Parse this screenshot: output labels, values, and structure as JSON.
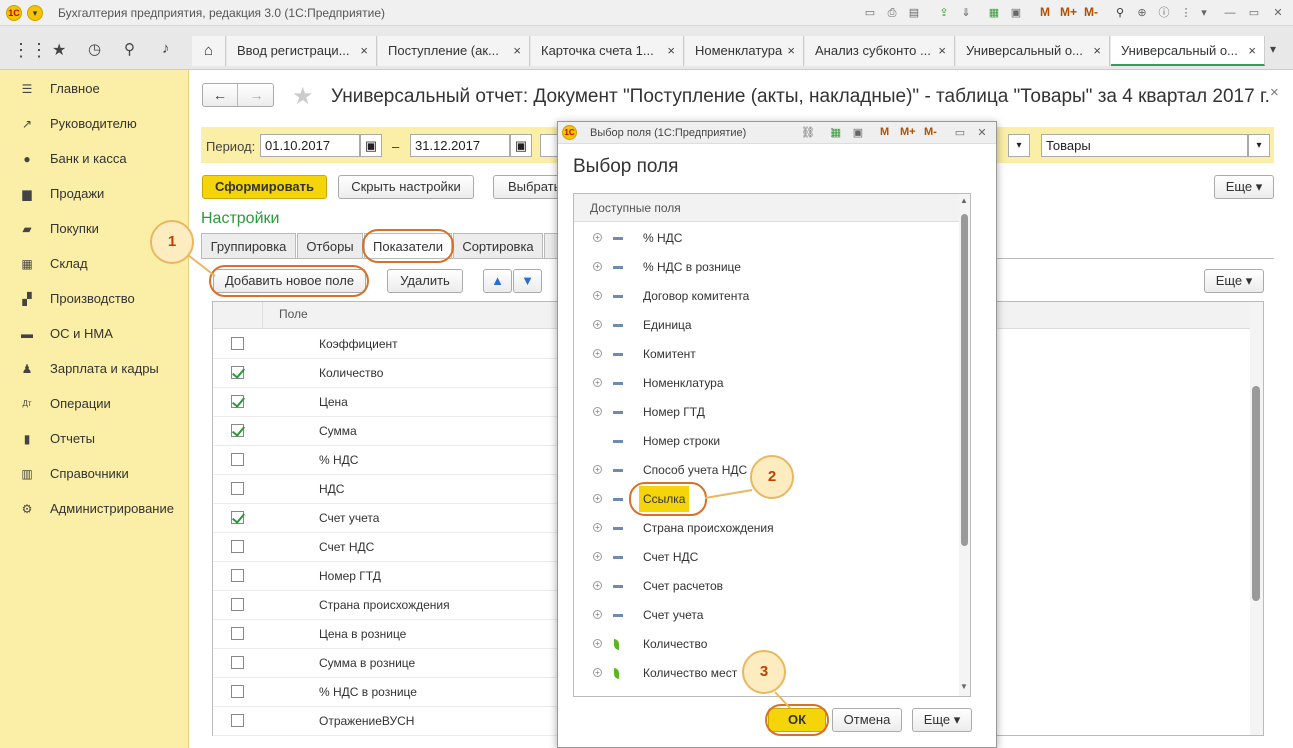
{
  "window": {
    "title": "Бухгалтерия предприятия, редакция 3.0 (1С:Предприятие)",
    "logo": "1С",
    "toolbar": {
      "m": "M",
      "m_plus": "M+",
      "m_minus": "M-"
    }
  },
  "tabs": [
    {
      "label": "Ввод регистраци..."
    },
    {
      "label": "Поступление (ак..."
    },
    {
      "label": "Карточка счета 1..."
    },
    {
      "label": "Номенклатура"
    },
    {
      "label": "Анализ субконто ..."
    },
    {
      "label": "Универсальный о..."
    },
    {
      "label": "Универсальный о..."
    }
  ],
  "tab_close": "×",
  "sidebar": {
    "items": [
      {
        "label": "Главное",
        "icon": "menu-icon"
      },
      {
        "label": "Руководителю",
        "icon": "chart-icon"
      },
      {
        "label": "Банк и касса",
        "icon": "coin-icon"
      },
      {
        "label": "Продажи",
        "icon": "cart-icon"
      },
      {
        "label": "Покупки",
        "icon": "truck-icon"
      },
      {
        "label": "Склад",
        "icon": "warehouse-icon"
      },
      {
        "label": "Производство",
        "icon": "factory-icon"
      },
      {
        "label": "ОС и НМА",
        "icon": "car-icon"
      },
      {
        "label": "Зарплата и кадры",
        "icon": "person-icon"
      },
      {
        "label": "Операции",
        "icon": "dt-kt-icon"
      },
      {
        "label": "Отчеты",
        "icon": "bar-chart-icon"
      },
      {
        "label": "Справочники",
        "icon": "book-icon"
      },
      {
        "label": "Администрирование",
        "icon": "gear-icon"
      }
    ]
  },
  "report": {
    "title": "Универсальный отчет: Документ \"Поступление (акты, накладные)\" - таблица \"Товары\" за 4 квартал 2017 г.",
    "period_label": "Период:",
    "date_from": "01.10.2017",
    "dash": "–",
    "date_to": "31.12.2017",
    "table_select": "Товары",
    "generate_button": "Сформировать",
    "hide_settings_button": "Скрыть настройки",
    "choose_button": "Выбрать",
    "more_button": "Еще",
    "settings_heading": "Настройки",
    "settings_tabs": [
      "Группировка",
      "Отборы",
      "Показатели",
      "Сортировка"
    ],
    "add_field_button": "Добавить новое поле",
    "delete_button": "Удалить",
    "more_button2": "Еще",
    "column_header": "Поле",
    "rows": [
      {
        "label": "Коэффициент",
        "checked": false
      },
      {
        "label": "Количество",
        "checked": true
      },
      {
        "label": "Цена",
        "checked": true
      },
      {
        "label": "Сумма",
        "checked": true
      },
      {
        "label": "% НДС",
        "checked": false
      },
      {
        "label": "НДС",
        "checked": false
      },
      {
        "label": "Счет учета",
        "checked": true
      },
      {
        "label": "Счет НДС",
        "checked": false
      },
      {
        "label": "Номер ГТД",
        "checked": false
      },
      {
        "label": "Страна происхождения",
        "checked": false
      },
      {
        "label": "Цена в рознице",
        "checked": false
      },
      {
        "label": "Сумма в рознице",
        "checked": false
      },
      {
        "label": "% НДС в рознице",
        "checked": false
      },
      {
        "label": "ОтражениеВУСН",
        "checked": false
      }
    ]
  },
  "dialog": {
    "window_title": "Выбор поля  (1С:Предприятие)",
    "heading": "Выбор поля",
    "list_header": "Доступные поля",
    "fields": [
      {
        "label": "% НДС",
        "expand": true,
        "kind": "dim"
      },
      {
        "label": "% НДС в рознице",
        "expand": true,
        "kind": "dim"
      },
      {
        "label": "Договор комитента",
        "expand": true,
        "kind": "dim"
      },
      {
        "label": "Единица",
        "expand": true,
        "kind": "dim"
      },
      {
        "label": "Комитент",
        "expand": true,
        "kind": "dim"
      },
      {
        "label": "Номенклатура",
        "expand": true,
        "kind": "dim"
      },
      {
        "label": "Номер ГТД",
        "expand": true,
        "kind": "dim"
      },
      {
        "label": "Номер строки",
        "expand": false,
        "kind": "dim"
      },
      {
        "label": "Способ учета НДС",
        "expand": true,
        "kind": "dim"
      },
      {
        "label": "Ссылка",
        "expand": true,
        "kind": "dim",
        "selected": true
      },
      {
        "label": "Страна происхождения",
        "expand": true,
        "kind": "dim"
      },
      {
        "label": "Счет НДС",
        "expand": true,
        "kind": "dim"
      },
      {
        "label": "Счет расчетов",
        "expand": true,
        "kind": "dim"
      },
      {
        "label": "Счет учета",
        "expand": true,
        "kind": "dim"
      },
      {
        "label": "Количество",
        "expand": true,
        "kind": "measure"
      },
      {
        "label": "Количество мест",
        "expand": true,
        "kind": "measure"
      }
    ],
    "ok_button": "ОК",
    "cancel_button": "Отмена",
    "more_button": "Еще"
  },
  "callouts": [
    "1",
    "2",
    "3"
  ],
  "colors": {
    "sidebar": "#fbeea6",
    "accent_yellow": "#f5d50a",
    "settings_green": "#2a9a3a",
    "callout_border": "#d9702a"
  }
}
